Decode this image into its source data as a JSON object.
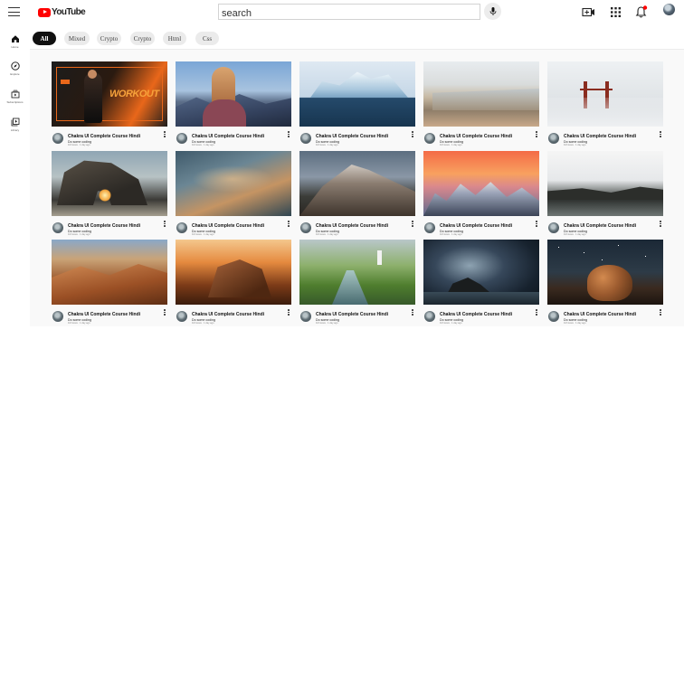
{
  "header": {
    "logo_text": "YouTube",
    "search_placeholder": "search"
  },
  "sidebar": {
    "items": [
      {
        "label": "Home",
        "icon": "home-icon"
      },
      {
        "label": "Explore",
        "icon": "compass-icon"
      },
      {
        "label": "Subscriptions",
        "icon": "subscriptions-icon"
      },
      {
        "label": "Library",
        "icon": "library-icon"
      }
    ]
  },
  "chips": [
    "All",
    "Mixed",
    "Crypto",
    "Crypto",
    "Html",
    "Css"
  ],
  "videos": [
    {
      "title": "Chakra UI Complete Course Hindi",
      "channel": "Do some coding",
      "meta": "1M views · 1 day ago",
      "thumb": "workout-banner"
    },
    {
      "title": "Chakra UI Complete Course Hindi",
      "channel": "Do some coding",
      "meta": "1M views · 1 day ago",
      "thumb": "girl-mountains"
    },
    {
      "title": "Chakra UI Complete Course Hindi",
      "channel": "Do some coding",
      "meta": "1M views · 1 day ago",
      "thumb": "iceberg"
    },
    {
      "title": "Chakra UI Complete Course Hindi",
      "channel": "Do some coding",
      "meta": "1M views · 1 day ago",
      "thumb": "beach"
    },
    {
      "title": "Chakra UI Complete Course Hindi",
      "channel": "Do some coding",
      "meta": "1M views · 1 day ago",
      "thumb": "bridge-fog"
    },
    {
      "title": "Chakra UI Complete Course Hindi",
      "channel": "Do some coding",
      "meta": "1M views · 1 day ago",
      "thumb": "rock-arch"
    },
    {
      "title": "Chakra UI Complete Course Hindi",
      "channel": "Do some coding",
      "meta": "1M views · 1 day ago",
      "thumb": "clouds"
    },
    {
      "title": "Chakra UI Complete Course Hindi",
      "channel": "Do some coding",
      "meta": "1M views · 1 day ago",
      "thumb": "mountain"
    },
    {
      "title": "Chakra UI Complete Course Hindi",
      "channel": "Do some coding",
      "meta": "1M views · 1 day ago",
      "thumb": "sunset-peaks"
    },
    {
      "title": "Chakra UI Complete Course Hindi",
      "channel": "Do some coding",
      "meta": "1M views · 1 day ago",
      "thumb": "shore"
    },
    {
      "title": "Chakra UI Complete Course Hindi",
      "channel": "Do some coding",
      "meta": "1M views · 1 day ago",
      "thumb": "desert"
    },
    {
      "title": "Chakra UI Complete Course Hindi",
      "channel": "Do some coding",
      "meta": "1M views · 1 day ago",
      "thumb": "desert-rock"
    },
    {
      "title": "Chakra UI Complete Course Hindi",
      "channel": "Do some coding",
      "meta": "1M views · 1 day ago",
      "thumb": "lighthouse"
    },
    {
      "title": "Chakra UI Complete Course Hindi",
      "channel": "Do some coding",
      "meta": "1M views · 1 day ago",
      "thumb": "milky-way"
    },
    {
      "title": "Chakra UI Complete Course Hindi",
      "channel": "Do some coding",
      "meta": "1M views · 1 day ago",
      "thumb": "boulder-night"
    }
  ],
  "colors": {
    "brand_red": "#ff0000",
    "active_chip": "#111111",
    "notification_dot": "#ff0000"
  }
}
